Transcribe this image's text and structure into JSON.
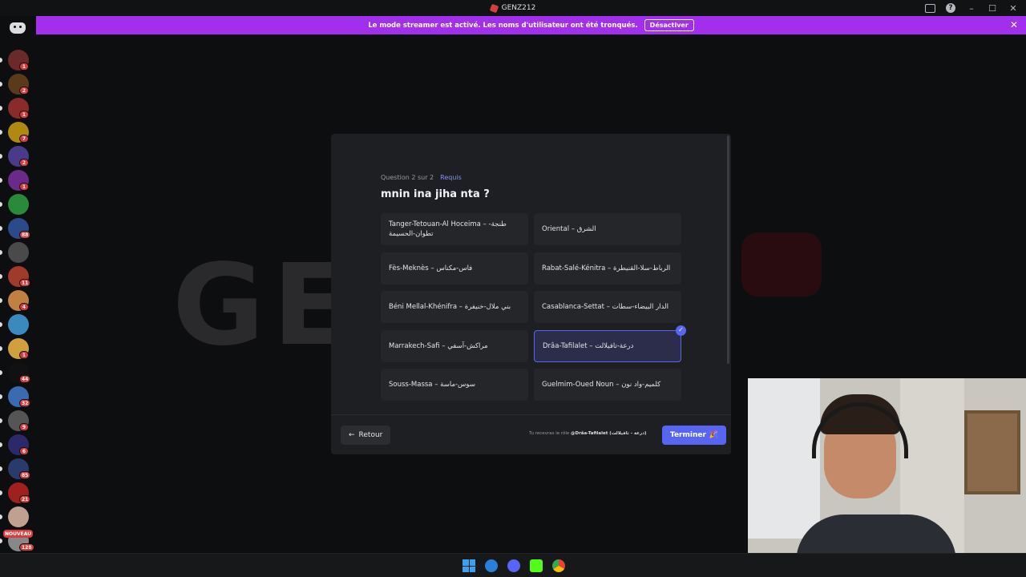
{
  "titlebar": {
    "title": "GENZ212"
  },
  "banner": {
    "message": "Le mode streamer est activé. Les noms d'utilisateur ont été tronqués.",
    "disable_label": "Désactiver"
  },
  "sidebar": {
    "badges": [
      "1",
      "2",
      "1",
      "7",
      "2",
      "1",
      "",
      "88",
      "",
      "11",
      "4",
      "",
      "1",
      "44",
      "32",
      "9",
      "6",
      "85",
      "21",
      "",
      "128"
    ],
    "new_label": "NOUVEAU"
  },
  "question": {
    "progress": "Question 2 sur 2",
    "required": "Requis",
    "title": "mnin ina jiha nta ?"
  },
  "options": [
    {
      "label": "Tanger-Tetouan-Al Hoceima – طنجة-تطوان-الحسيمة",
      "selected": false
    },
    {
      "label": "Oriental – الشرق",
      "selected": false
    },
    {
      "label": "Fès-Meknès – فاس-مكناس",
      "selected": false
    },
    {
      "label": "Rabat-Salé-Kénitra – الرباط-سلا-القنيطرة",
      "selected": false
    },
    {
      "label": "Béni Mellal-Khénifra – بني ملال-خنيفرة",
      "selected": false
    },
    {
      "label": "Casablanca-Settat – الدار البيضاء-سطات",
      "selected": false
    },
    {
      "label": "Marrakech-Safi – مراكش-آسفي",
      "selected": false
    },
    {
      "label": "Drâa-Tafilalet – درعة-تافيلالت",
      "selected": true
    },
    {
      "label": "Souss-Massa – سوس-ماسة",
      "selected": false
    },
    {
      "label": "Guelmim-Oued Noun – كلميم-واد نون",
      "selected": false
    }
  ],
  "footer": {
    "back_label": "Retour",
    "role_note_prefix": "Tu recevras le rôle",
    "role_note_role": "@Drâa-Tafilalet (درعة - تافيلالت)",
    "finish_label": "Terminer"
  }
}
